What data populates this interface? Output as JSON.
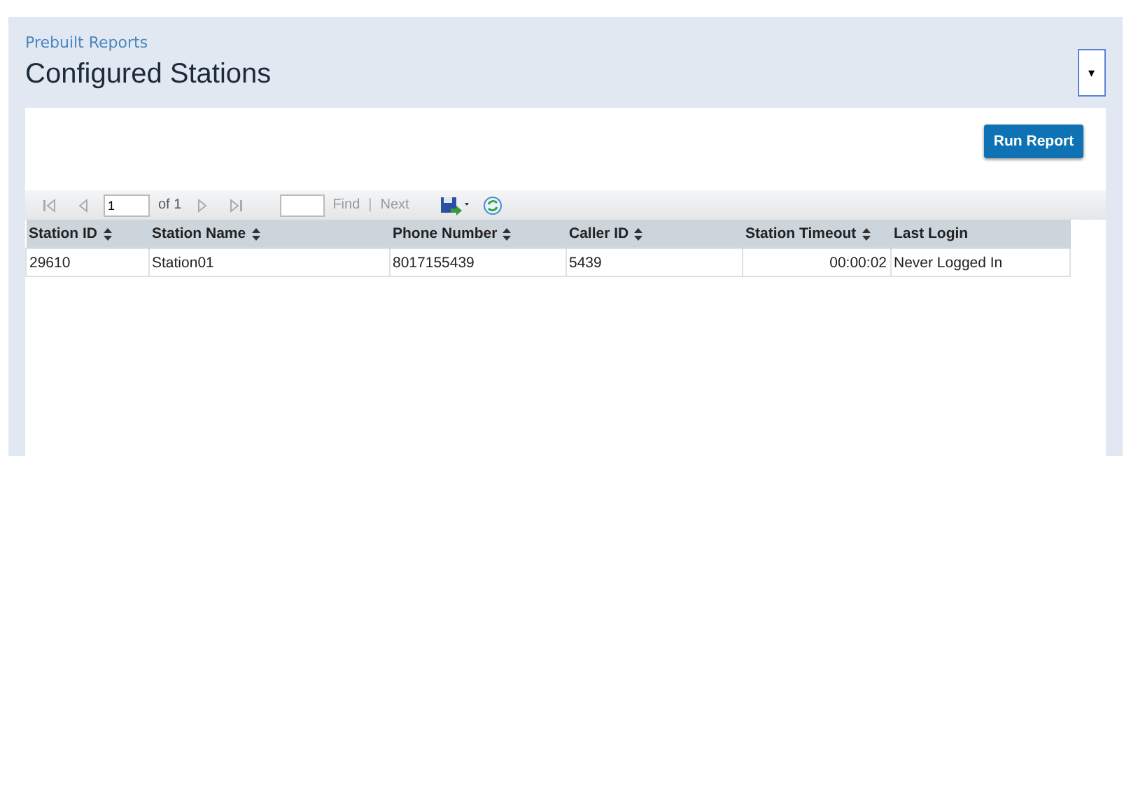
{
  "breadcrumb": "Prebuilt Reports",
  "title": "Configured Stations",
  "menu_button": {
    "label": "▾"
  },
  "run_button": "Run Report",
  "toolbar": {
    "page": "1",
    "of": "of 1",
    "find": "Find",
    "separator": "|",
    "next": "Next",
    "find_disabled": true
  },
  "table": {
    "columns": [
      {
        "label": "Station ID",
        "sortable": true,
        "kind": "text"
      },
      {
        "label": "Station Name",
        "sortable": true,
        "kind": "text"
      },
      {
        "label": "Phone Number",
        "sortable": true,
        "kind": "text"
      },
      {
        "label": "Caller ID",
        "sortable": true,
        "kind": "text"
      },
      {
        "label": "Station Timeout",
        "sortable": true,
        "kind": "duration"
      },
      {
        "label": "Last Login",
        "sortable": false,
        "kind": "text"
      }
    ],
    "rows": [
      [
        "29610",
        "Station01",
        "8017155439",
        "5439",
        "00:00:02",
        "Never Logged In"
      ]
    ]
  }
}
